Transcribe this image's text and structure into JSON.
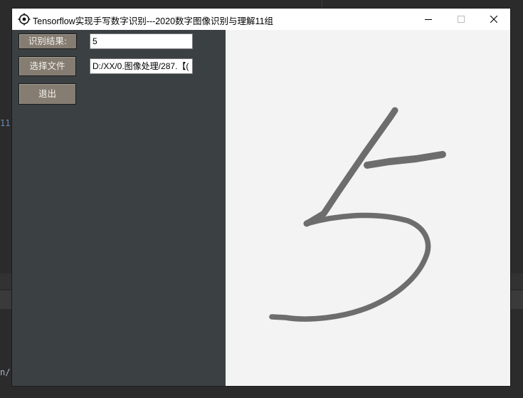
{
  "window": {
    "title": "Tensorflow实现手写数字识别---2020数字图像识别与理解11组"
  },
  "controls": {
    "result_label": "识别结果:",
    "result_value": "5",
    "select_file_label": "选择文件",
    "file_path": "D:/XX/0.图像处理/287.【(",
    "exit_label": "退出"
  },
  "background": {
    "gutter_text_1": "11,",
    "gutter_text_2": "n/"
  },
  "canvas": {
    "digit": "5",
    "stroke_color": "#6d6d6d"
  }
}
